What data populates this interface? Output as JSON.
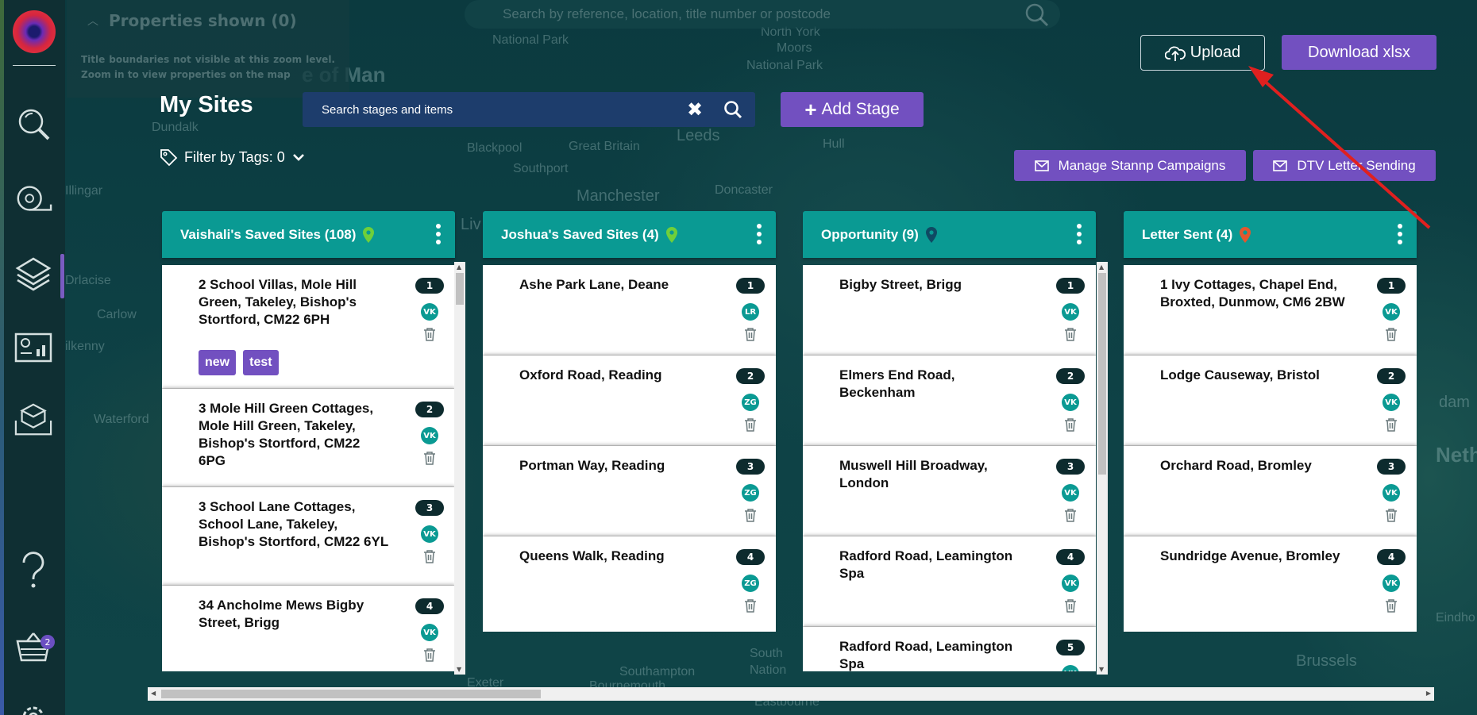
{
  "map": {
    "labels": [
      "National Park",
      "North York",
      "Moors",
      "National Park",
      "e of Man",
      "Dundalk",
      "Leeds",
      "Hull",
      "Blackpool",
      "Great Britain",
      "Southport",
      "Manchester",
      "Doncaster",
      "Illingar",
      "Drlacise",
      "Carlow",
      "ilkenny",
      "Waterford",
      "Liv",
      "Southampton",
      "Bournemouth",
      "South",
      "Nation",
      "Eastbourne",
      "Brussels",
      "dam",
      "Nethe",
      "Eindho",
      "Exeter"
    ],
    "search_placeholder": "Search by reference, location, title number or postcode"
  },
  "properties_panel": {
    "title": "Properties shown (0)",
    "text": "Title boundaries not visible at this zoom level. Zoom in to view properties on the map"
  },
  "header": {
    "upload_label": "Upload",
    "download_label": "Download xlsx",
    "title": "My Sites",
    "stage_search_placeholder": "Search stages and items",
    "add_stage_label": "Add Stage",
    "filter_label": "Filter by Tags: 0",
    "stannp_label": "Manage Stannp Campaigns",
    "dtv_label": "DTV Letter Sending"
  },
  "sidebar": {
    "basket_count": "2",
    "icons": [
      "search-icon",
      "measure-tape-icon",
      "layers-icon",
      "dashboard-icon",
      "map-3d-icon",
      "help-icon",
      "basket-icon",
      "settings-icon"
    ]
  },
  "columns": [
    {
      "title": "Vaishali's Saved Sites (108)",
      "pin_color": "#6fcf3a",
      "cards": [
        {
          "title": "2 School Villas, Mole Hill Green, Takeley, Bishop's Stortford, CM22 6PH",
          "num": "1",
          "user": "VK",
          "tags": [
            "new",
            "test"
          ]
        },
        {
          "title": "3 Mole Hill Green Cottages, Mole Hill Green, Takeley, Bishop's Stortford, CM22 6PG",
          "num": "2",
          "user": "VK",
          "tags": []
        },
        {
          "title": "3 School Lane Cottages, School Lane, Takeley, Bishop's Stortford, CM22 6YL",
          "num": "3",
          "user": "VK",
          "tags": []
        },
        {
          "title": "34 Ancholme Mews Bigby Street, Brigg",
          "num": "4",
          "user": "VK",
          "tags": []
        }
      ]
    },
    {
      "title": "Joshua's Saved Sites (4)",
      "pin_color": "#6fcf3a",
      "cards": [
        {
          "title": "Ashe Park Lane, Deane",
          "num": "1",
          "user": "LR",
          "tags": []
        },
        {
          "title": "Oxford Road, Reading",
          "num": "2",
          "user": "ZG",
          "tags": []
        },
        {
          "title": "Portman Way, Reading",
          "num": "3",
          "user": "ZG",
          "tags": []
        },
        {
          "title": "Queens Walk, Reading",
          "num": "4",
          "user": "ZG",
          "tags": []
        }
      ]
    },
    {
      "title": "Opportunity (9)",
      "pin_color": "#0f4a63",
      "cards": [
        {
          "title": "Bigby Street, Brigg",
          "num": "1",
          "user": "VK",
          "tags": []
        },
        {
          "title": "Elmers End Road, Beckenham",
          "num": "2",
          "user": "VK",
          "tags": []
        },
        {
          "title": "Muswell Hill Broadway, London",
          "num": "3",
          "user": "VK",
          "tags": []
        },
        {
          "title": "Radford Road, Leamington Spa",
          "num": "4",
          "user": "VK",
          "tags": []
        },
        {
          "title": "Radford Road, Leamington Spa",
          "num": "5",
          "user": "VK",
          "tags": []
        }
      ]
    },
    {
      "title": "Letter Sent (4)",
      "pin_color": "#e4572e",
      "cards": [
        {
          "title": "1 Ivy Cottages, Chapel End, Broxted, Dunmow, CM6 2BW",
          "num": "1",
          "user": "VK",
          "tags": []
        },
        {
          "title": "Lodge Causeway, Bristol",
          "num": "2",
          "user": "VK",
          "tags": []
        },
        {
          "title": "Orchard Road, Bromley",
          "num": "3",
          "user": "VK",
          "tags": []
        },
        {
          "title": "Sundridge Avenue, Bromley",
          "num": "4",
          "user": "VK",
          "tags": []
        }
      ]
    }
  ],
  "colors": {
    "accent_purple": "#7250c0",
    "header_teal": "#0a9a93",
    "annotation_arrow": "#e0201f"
  }
}
